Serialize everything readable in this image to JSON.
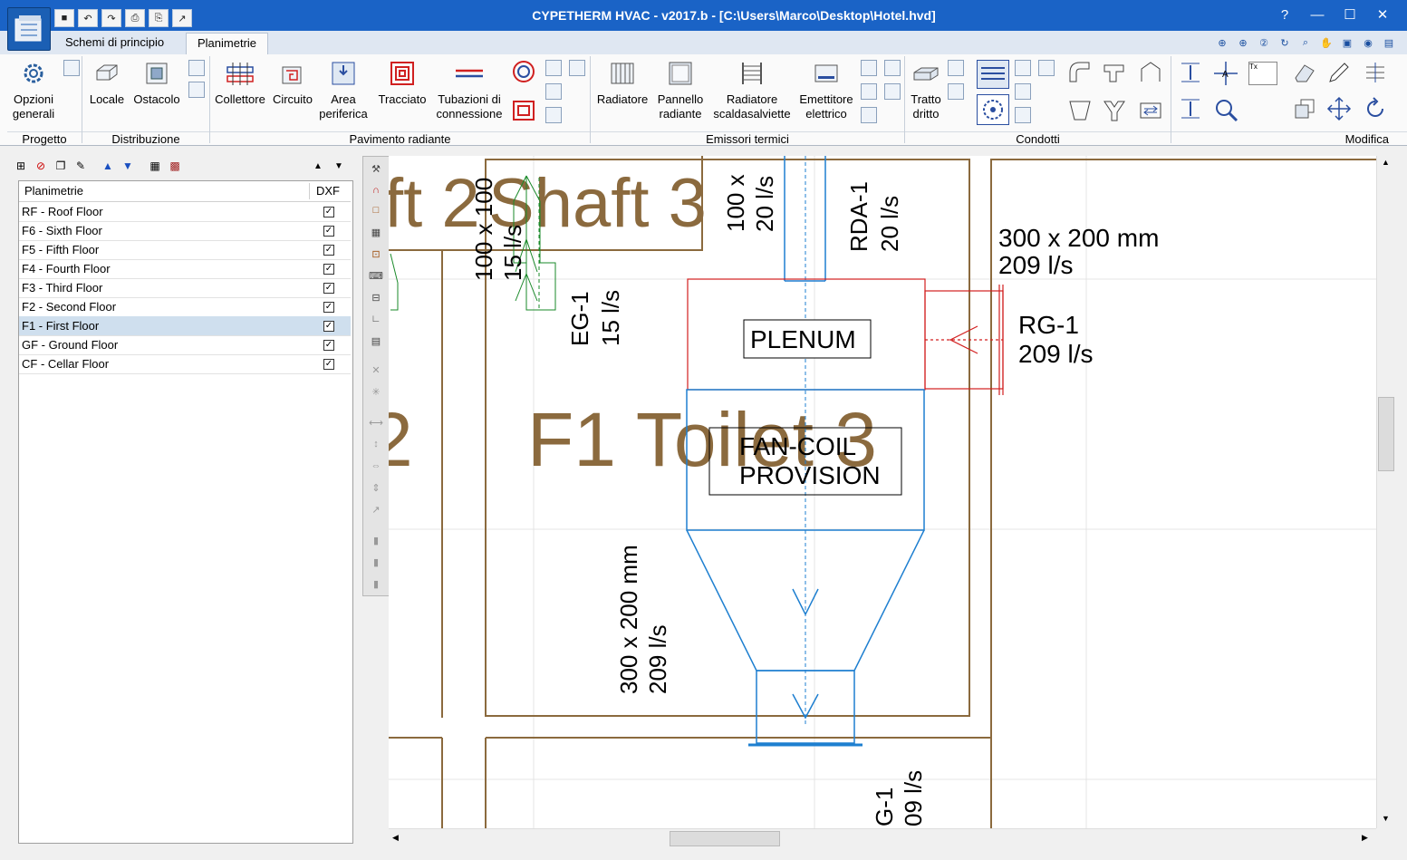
{
  "app": {
    "title": "CYPETHERM HVAC - v2017.b - [C:\\Users\\Marco\\Desktop\\Hotel.hvd]",
    "help": "?",
    "minimize": "—",
    "maximize": "☐",
    "close": "✕"
  },
  "tabs": [
    {
      "label": "Schemi di principio"
    },
    {
      "label": "Planimetrie"
    }
  ],
  "ribbon": {
    "opzioni": {
      "line1": "Opzioni",
      "line2": "generali"
    },
    "locale": "Locale",
    "ostacolo": "Ostacolo",
    "collettore": "Collettore",
    "circuito": "Circuito",
    "area": {
      "line1": "Area",
      "line2": "periferica"
    },
    "tracciato": "Tracciato",
    "tubazioni": {
      "line1": "Tubazioni di",
      "line2": "connessione"
    },
    "radiatore": "Radiatore",
    "pannello": {
      "line1": "Pannello",
      "line2": "radiante"
    },
    "scalda": {
      "line1": "Radiatore",
      "line2": "scaldasalviette"
    },
    "emettitore": {
      "line1": "Emettitore",
      "line2": "elettrico"
    },
    "tratto": {
      "line1": "Tratto",
      "line2": "dritto"
    },
    "groups": {
      "progetto": "Progetto",
      "distribuzione": "Distribuzione",
      "pavimento": "Pavimento radiante",
      "emissori": "Emissori termici",
      "condotti": "Condotti",
      "modifica": "Modifica"
    }
  },
  "floors_panel": {
    "col_name": "Planimetrie",
    "col_dxf": "DXF",
    "selected_index": 6,
    "rows": [
      {
        "name": "RF - Roof Floor",
        "dxf": "✓"
      },
      {
        "name": "F6 - Sixth Floor",
        "dxf": "✓"
      },
      {
        "name": "F5 - Fifth Floor",
        "dxf": "✓"
      },
      {
        "name": "F4 - Fourth Floor",
        "dxf": "✓"
      },
      {
        "name": "F3 - Third Floor",
        "dxf": "✓"
      },
      {
        "name": "F2 - Second Floor",
        "dxf": "✓"
      },
      {
        "name": "F1 - First Floor",
        "dxf": "✓"
      },
      {
        "name": "GF - Ground Floor",
        "dxf": "✓"
      },
      {
        "name": "CF - Cellar Floor",
        "dxf": "✓"
      }
    ]
  },
  "drawing": {
    "room_shaft_big": "Shaft 3",
    "room_shaft_partial": "ft 2",
    "room_toilet": "F1 Toilet 3",
    "room_edge_digit": "2",
    "plenum": "PLENUM",
    "fancoil_line1": "FAN-COIL",
    "fancoil_line2": "PROVISION",
    "duct_top_a": "100 x 100",
    "duct_top_a_flow": "15 l/s",
    "duct_top_b": "100 x",
    "duct_top_b_flow": "20 l/s",
    "eg1": "EG-1",
    "eg1_flow": "15 l/s",
    "rda1": "RDA-1",
    "rda1_flow": "20 l/s",
    "duct_right": "300 x 200 mm",
    "duct_right_flow": "209 l/s",
    "rg1": "RG-1",
    "rg1_flow": "209 l/s",
    "duct_vert": "300 x 200 mm",
    "duct_vert_flow": "209 l/s",
    "g1_bottom": "G-1",
    "g1_bottom_flow": "09 l/s"
  },
  "colors": {
    "titlebar": "#1a63c6",
    "wall": "#8b6a3e",
    "room_text": "#8b6a3e",
    "duct_blue": "#1e7fd0",
    "plenum_red": "#d21e1e",
    "grille_green": "#1a8a2a"
  }
}
